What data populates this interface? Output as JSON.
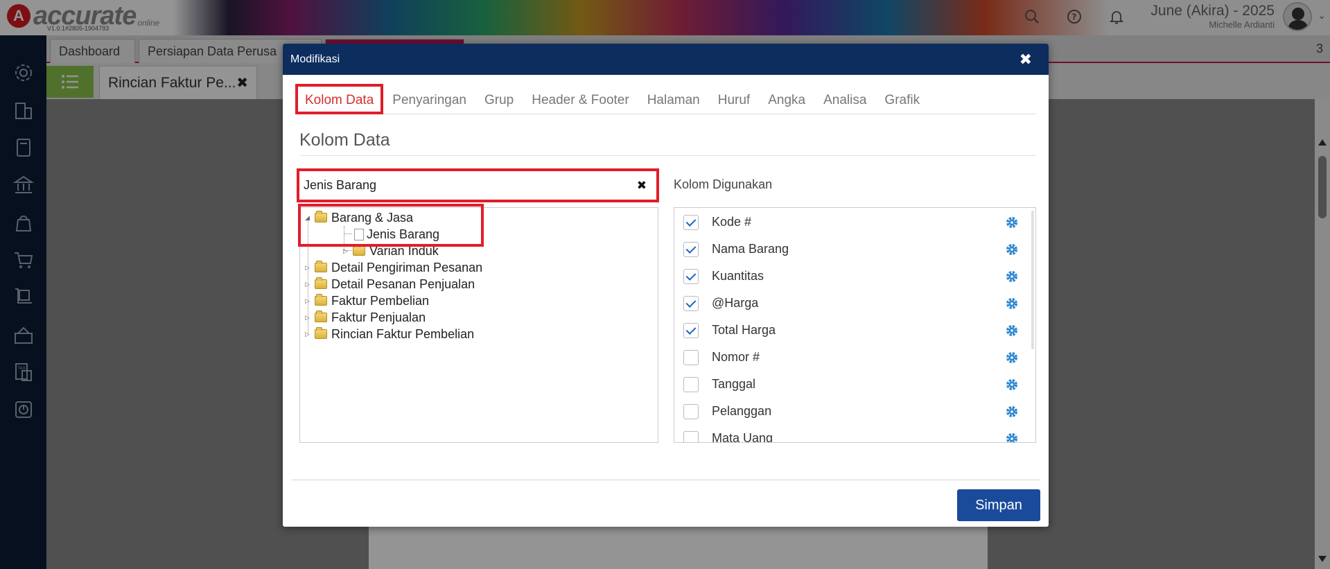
{
  "app": {
    "logo_text": "accurate",
    "logo_sub": "online",
    "version": "V1.0.1#2805-1904793",
    "company": "June (Akira) - 2025",
    "user": "Michelle Ardianti"
  },
  "tabs": {
    "items": [
      {
        "label": "Dashboard"
      },
      {
        "label": "Persiapan Data Perusa"
      },
      {
        "label": ""
      }
    ],
    "count": "3",
    "sub_tab_label": "Rincian Faktur Pe...",
    "sub_tab_close": "✖"
  },
  "modal": {
    "title": "Modifikasi",
    "close": "✖",
    "tabs": [
      "Kolom Data",
      "Penyaringan",
      "Grup",
      "Header & Footer",
      "Halaman",
      "Huruf",
      "Angka",
      "Analisa",
      "Grafik"
    ],
    "section_title": "Kolom Data",
    "search_value": "Jenis Barang",
    "search_clear": "✖",
    "tree": [
      {
        "label": "Barang & Jasa",
        "type": "folder",
        "level": 0,
        "expanded": true
      },
      {
        "label": "Jenis Barang",
        "type": "doc",
        "level": 1
      },
      {
        "label": "Varian Induk",
        "type": "folder",
        "level": 1
      },
      {
        "label": "Detail Pengiriman Pesanan",
        "type": "folder",
        "level": 0
      },
      {
        "label": "Detail Pesanan Penjualan",
        "type": "folder",
        "level": 0
      },
      {
        "label": "Faktur Pembelian",
        "type": "folder",
        "level": 0
      },
      {
        "label": "Faktur Penjualan",
        "type": "folder",
        "level": 0
      },
      {
        "label": "Rincian Faktur Pembelian",
        "type": "folder",
        "level": 0
      }
    ],
    "used_label": "Kolom Digunakan",
    "used_columns": [
      {
        "label": "Kode #",
        "checked": true
      },
      {
        "label": "Nama Barang",
        "checked": true
      },
      {
        "label": "Kuantitas",
        "checked": true
      },
      {
        "label": "@Harga",
        "checked": true
      },
      {
        "label": "Total Harga",
        "checked": true
      },
      {
        "label": "Nomor #",
        "checked": false
      },
      {
        "label": "Tanggal",
        "checked": false
      },
      {
        "label": "Pelanggan",
        "checked": false
      },
      {
        "label": "Mata Uang",
        "checked": false
      }
    ],
    "save_label": "Simpan"
  },
  "colors": {
    "accent_red": "#e11d2a",
    "header_navy": "#0c2d5e",
    "save_blue": "#1a4b9b",
    "gear_blue": "#2f88d0"
  }
}
